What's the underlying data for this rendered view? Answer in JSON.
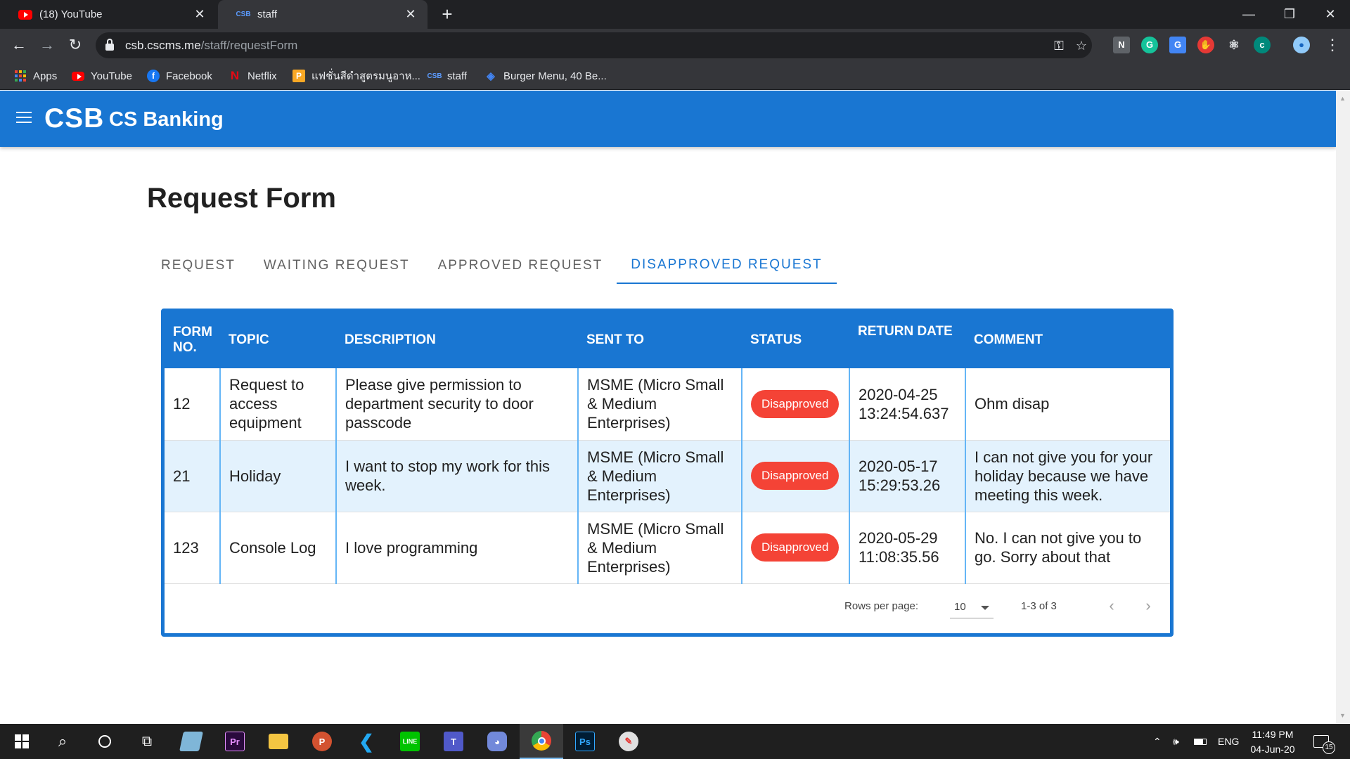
{
  "browser": {
    "tabs": [
      {
        "title": "(18) YouTube",
        "favicon": "youtube-icon"
      },
      {
        "title": "staff",
        "favicon": "csb-icon"
      }
    ],
    "url_domain": "csb.cscms.me",
    "url_path": "/staff/requestForm",
    "bookmarks": [
      {
        "label": "Apps",
        "icon": "apps-grid-icon"
      },
      {
        "label": "YouTube",
        "icon": "youtube-icon"
      },
      {
        "label": "Facebook",
        "icon": "facebook-icon"
      },
      {
        "label": "Netflix",
        "icon": "netflix-icon"
      },
      {
        "label": "แฟชั่นสีดำสูตรมนูอาห...",
        "icon": "bookmark-p-icon"
      },
      {
        "label": "staff",
        "icon": "csb-icon"
      },
      {
        "label": "Burger Menu, 40 Be...",
        "icon": "burger-icon"
      }
    ]
  },
  "app": {
    "brand": "CSB",
    "name": "CS Banking",
    "primary_color": "#1976d2"
  },
  "page": {
    "title": "Request Form",
    "tabs": [
      {
        "label": "REQUEST",
        "active": false
      },
      {
        "label": "WAITING REQUEST",
        "active": false
      },
      {
        "label": "APPROVED REQUEST",
        "active": false
      },
      {
        "label": "DISAPPROVED REQUEST",
        "active": true
      }
    ]
  },
  "table": {
    "headers": {
      "form_no": "FORM NO.",
      "topic": "TOPIC",
      "description": "DESCRIPTION",
      "sent_to": "SENT TO",
      "status": "STATUS",
      "return_date": "RETURN DATE",
      "comment": "COMMENT"
    },
    "rows": [
      {
        "form_no": "12",
        "topic": "Request to access equipment",
        "description": "Please give permission to department security to door passcode",
        "sent_to": "MSME (Micro Small & Medium Enterprises)",
        "status": "Disapproved",
        "return_date": "2020-04-25 13:24:54.637",
        "comment": "Ohm disap"
      },
      {
        "form_no": "21",
        "topic": "Holiday",
        "description": "I want to stop my work for this week.",
        "sent_to": "MSME (Micro Small & Medium Enterprises)",
        "status": "Disapproved",
        "return_date": "2020-05-17 15:29:53.26",
        "comment": "I can not give you for your holiday because we have meeting this week."
      },
      {
        "form_no": "123",
        "topic": "Console Log",
        "description": "I love programming",
        "sent_to": "MSME (Micro Small & Medium Enterprises)",
        "status": "Disapproved",
        "return_date": "2020-05-29 11:08:35.56",
        "comment": "No. I can not give you to go. Sorry about that"
      }
    ],
    "footer": {
      "rows_per_page_label": "Rows per page:",
      "rows_per_page_value": "10",
      "range": "1-3 of 3"
    },
    "status_color": "#f44336"
  },
  "taskbar": {
    "apps": [
      "windows-start-icon",
      "search-icon",
      "cortana-icon",
      "task-view-icon",
      "notepad-icon",
      "premiere-pro-icon",
      "file-explorer-icon",
      "powerpoint-icon",
      "vscode-icon",
      "line-icon",
      "teams-icon",
      "discord-icon",
      "chrome-icon",
      "photoshop-icon",
      "paint-icon"
    ],
    "language": "ENG",
    "time": "11:49 PM",
    "date": "04-Jun-20",
    "notifications": "15"
  }
}
